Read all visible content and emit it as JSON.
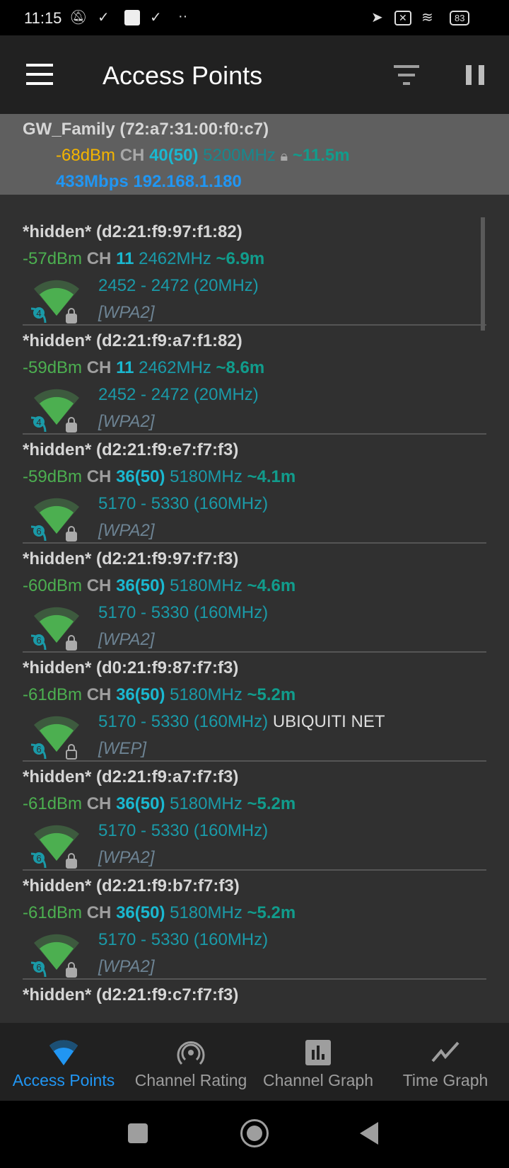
{
  "status_bar": {
    "time": "11:15",
    "battery": "83"
  },
  "toolbar": {
    "title": "Access Points"
  },
  "connected": {
    "ssid_bssid": "GW_Family (72:a7:31:00:f0:c7)",
    "dbm": "-68dBm",
    "ch_label": "CH",
    "channel": "40(50)",
    "freq": "5200MHz",
    "distance": "~11.5m",
    "speed_ip": "433Mbps 192.168.1.180",
    "dbm_color": "#f4b400"
  },
  "access_points": [
    {
      "title": "*hidden* (d2:21:f9:97:f1:82)",
      "dbm": "-57dBm",
      "ch_label": "CH",
      "channel": "11",
      "freq": "2462MHz",
      "distance": "~6.9m",
      "range": "2452 - 2472 (20MHz)",
      "vendor": "",
      "security": "[WPA2]",
      "wifi_gen": "4"
    },
    {
      "title": "*hidden* (d2:21:f9:a7:f1:82)",
      "dbm": "-59dBm",
      "ch_label": "CH",
      "channel": "11",
      "freq": "2462MHz",
      "distance": "~8.6m",
      "range": "2452 - 2472 (20MHz)",
      "vendor": "",
      "security": "[WPA2]",
      "wifi_gen": "4"
    },
    {
      "title": "*hidden* (d2:21:f9:e7:f7:f3)",
      "dbm": "-59dBm",
      "ch_label": "CH",
      "channel": "36(50)",
      "freq": "5180MHz",
      "distance": "~4.1m",
      "range": "5170 - 5330 (160MHz)",
      "vendor": "",
      "security": "[WPA2]",
      "wifi_gen": "6"
    },
    {
      "title": "*hidden* (d2:21:f9:97:f7:f3)",
      "dbm": "-60dBm",
      "ch_label": "CH",
      "channel": "36(50)",
      "freq": "5180MHz",
      "distance": "~4.6m",
      "range": "5170 - 5330 (160MHz)",
      "vendor": "",
      "security": "[WPA2]",
      "wifi_gen": "6"
    },
    {
      "title": "*hidden* (d0:21:f9:87:f7:f3)",
      "dbm": "-61dBm",
      "ch_label": "CH",
      "channel": "36(50)",
      "freq": "5180MHz",
      "distance": "~5.2m",
      "range": "5170 - 5330 (160MHz)",
      "vendor": "UBIQUITI NET",
      "security": "[WEP]",
      "wifi_gen": "6"
    },
    {
      "title": "*hidden* (d2:21:f9:a7:f7:f3)",
      "dbm": "-61dBm",
      "ch_label": "CH",
      "channel": "36(50)",
      "freq": "5180MHz",
      "distance": "~5.2m",
      "range": "5170 - 5330 (160MHz)",
      "vendor": "",
      "security": "[WPA2]",
      "wifi_gen": "6"
    },
    {
      "title": "*hidden* (d2:21:f9:b7:f7:f3)",
      "dbm": "-61dBm",
      "ch_label": "CH",
      "channel": "36(50)",
      "freq": "5180MHz",
      "distance": "~5.2m",
      "range": "5170 - 5330 (160MHz)",
      "vendor": "",
      "security": "[WPA2]",
      "wifi_gen": "6"
    },
    {
      "title": "*hidden* (d2:21:f9:c7:f7:f3)"
    }
  ],
  "bottom_nav": [
    {
      "label": "Access Points",
      "icon": "wifi-icon",
      "active": true
    },
    {
      "label": "Channel Rating",
      "icon": "antenna-icon",
      "active": false
    },
    {
      "label": "Channel Graph",
      "icon": "bar-chart-icon",
      "active": false
    },
    {
      "label": "Time Graph",
      "icon": "line-chart-icon",
      "active": false
    }
  ],
  "colors": {
    "active": "#2196f3",
    "signal": "#4caf50",
    "background": "#303030"
  }
}
